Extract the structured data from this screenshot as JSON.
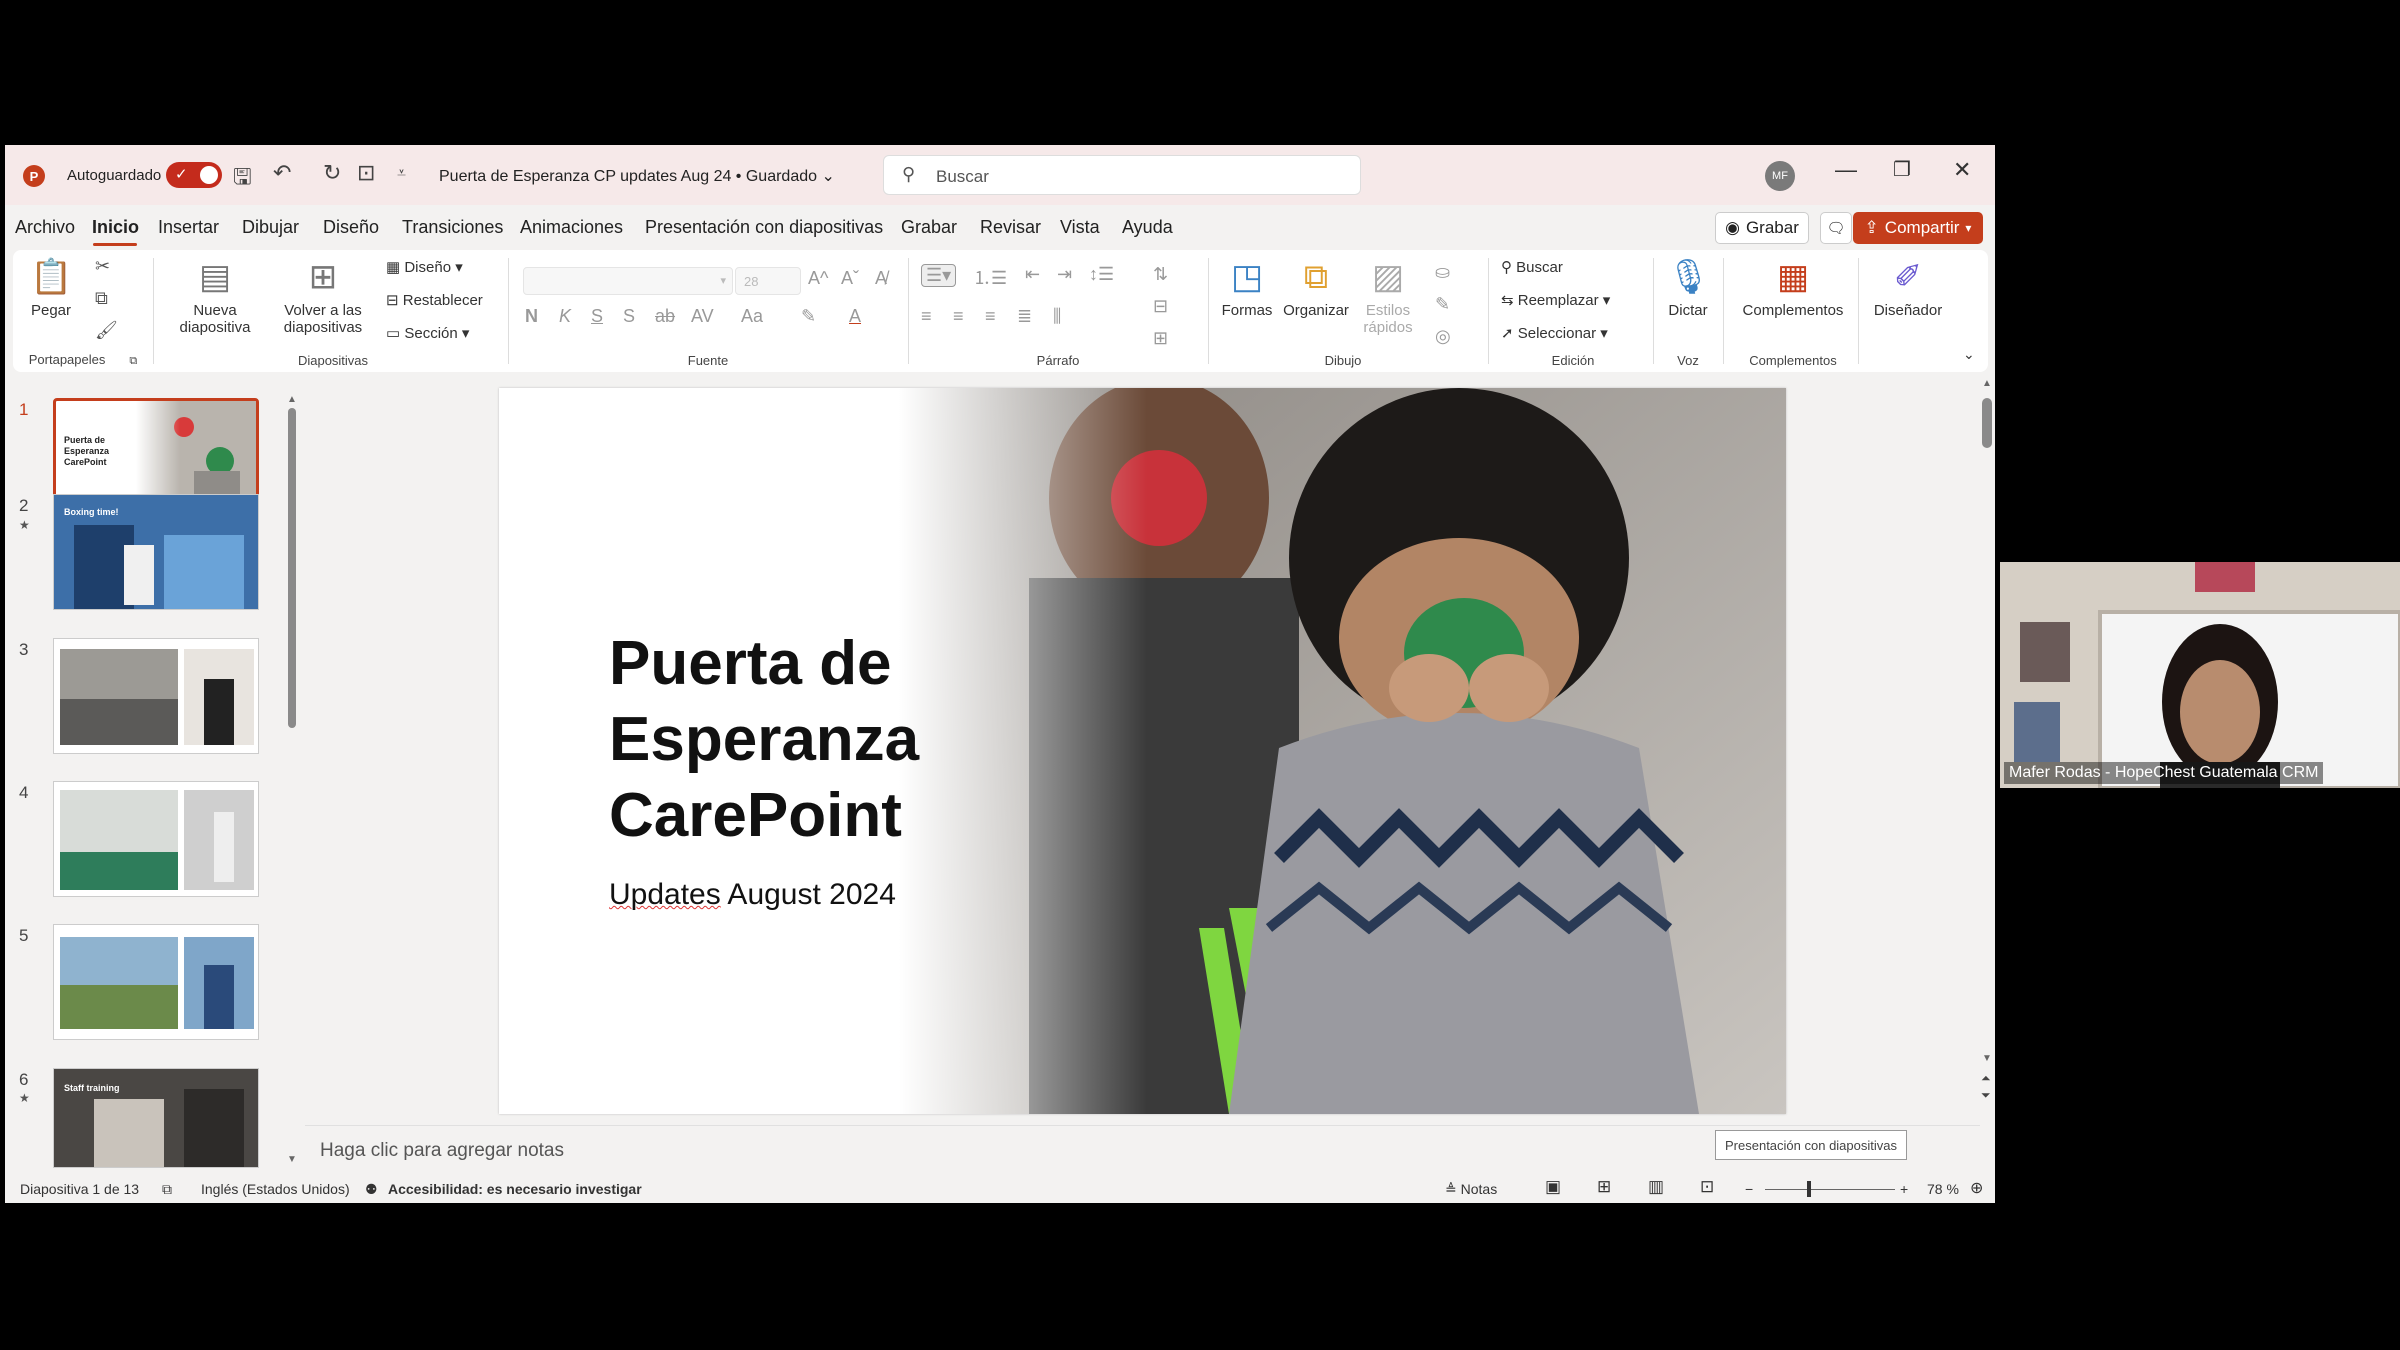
{
  "titlebar": {
    "autosave_label": "Autoguardado",
    "doc_title": "Puerta de Esperanza CP updates Aug 24 • Guardado ⌄",
    "search_placeholder": "Buscar",
    "avatar_initials": "MF"
  },
  "menu": {
    "tabs": [
      "Archivo",
      "Inicio",
      "Insertar",
      "Dibujar",
      "Diseño",
      "Transiciones",
      "Animaciones",
      "Presentación con diapositivas",
      "Grabar",
      "Revisar",
      "Vista",
      "Ayuda"
    ],
    "active_tab": "Inicio",
    "grabar_label": "Grabar",
    "share_label": "Compartir"
  },
  "ribbon": {
    "portapapeles": {
      "name": "Portapapeles",
      "paste": "Pegar"
    },
    "diapositivas": {
      "name": "Diapositivas",
      "new_slide": "Nueva diapositiva",
      "reuse": "Volver a las diapositivas",
      "layout": "Diseño",
      "reset": "Restablecer",
      "section": "Sección"
    },
    "fuente": {
      "name": "Fuente",
      "size": "28"
    },
    "parrafo": {
      "name": "Párrafo"
    },
    "dibujo": {
      "name": "Dibujo",
      "shapes": "Formas",
      "arrange": "Organizar",
      "quick_styles": "Estilos rápidos"
    },
    "edicion": {
      "name": "Edición",
      "find": "Buscar",
      "replace": "Reemplazar",
      "select": "Seleccionar"
    },
    "voz": {
      "name": "Voz",
      "dictate": "Dictar"
    },
    "complementos": {
      "name": "Complementos",
      "addins": "Complementos",
      "designer": "Diseñador"
    }
  },
  "thumbnails": [
    {
      "num": "1",
      "star": false,
      "label": "Puerta de Esperanza CarePoint"
    },
    {
      "num": "2",
      "star": true,
      "label": "Boxing time!"
    },
    {
      "num": "3",
      "star": false,
      "label": ""
    },
    {
      "num": "4",
      "star": false,
      "label": ""
    },
    {
      "num": "5",
      "star": false,
      "label": ""
    },
    {
      "num": "6",
      "star": true,
      "label": "Staff training"
    }
  ],
  "slide": {
    "title": "Puerta de\nEsperanza\nCarePoint",
    "subtitle_word1": "Updates",
    "subtitle_rest": " August 2024"
  },
  "notes": {
    "placeholder": "Haga clic para agregar notas",
    "tooltip": "Presentación con diapositivas"
  },
  "status": {
    "slide_counter": "Diapositiva 1 de 13",
    "language": "Inglés (Estados Unidos)",
    "accessibility": "Accesibilidad: es necesario investigar",
    "notes_label": "Notas",
    "zoom": "78 %"
  },
  "webcam": {
    "caption": "Mafer Rodas - HopeChest Guatemala CRM"
  },
  "colors": {
    "accent": "#c43e1c",
    "titlebar": "#f6e9e9"
  }
}
